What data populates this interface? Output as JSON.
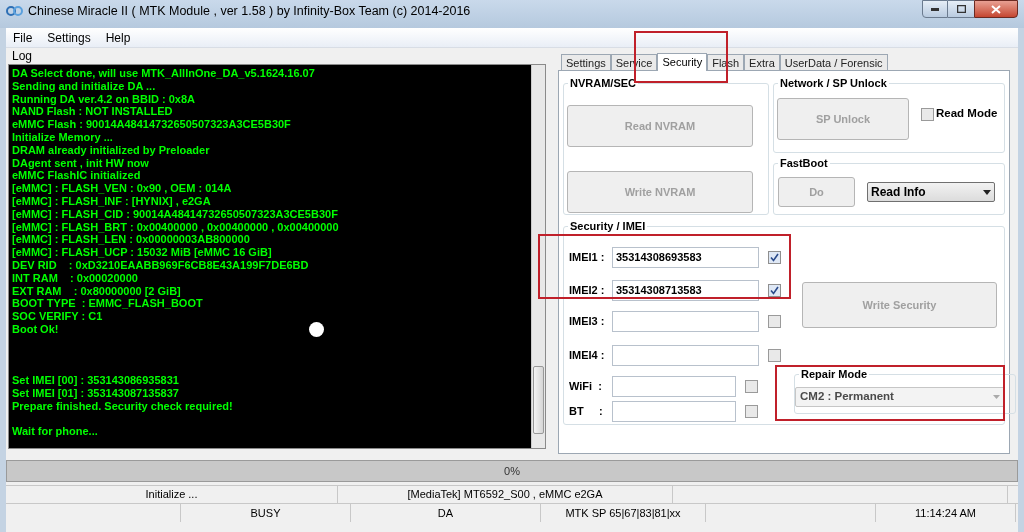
{
  "window": {
    "title": "Chinese Miracle II ( MTK Module , ver 1.58 ) by Infinity-Box Team (c) 2014-2016"
  },
  "menu": [
    "File",
    "Settings",
    "Help"
  ],
  "log": {
    "label": "Log",
    "blocks": [
      {
        "kind": "text",
        "lines": [
          "DA Select done, will use MTK_AllInOne_DA_v5.1624.16.07",
          "Sending and initialize DA ...",
          "Running DA ver.4.2 on BBID : 0x8A",
          "NAND Flash : NOT INSTALLED",
          "eMMC Flash : 90014A48414732650507323A3CE5B30F",
          "Initialize Memory ...",
          "DRAM already initialized by Preloader",
          "DAgent sent , init HW now",
          "eMMC FlashIC initialized",
          "[eMMC] : FLASH_VEN : 0x90 , OEM : 014A",
          "[eMMC] : FLASH_INF : [HYNIX] , e2GA",
          "[eMMC] : FLASH_CID : 90014A48414732650507323A3CE5B30F",
          "[eMMC] : FLASH_BRT : 0x00400000 , 0x00400000 , 0x00400000",
          "[eMMC] : FLASH_LEN : 0x00000003AB800000",
          "[eMMC] : FLASH_UCP : 15032 MiB [eMMC 16 GiB]",
          "DEV RID    : 0xD3210EAABB969F6CB8E43A199F7DE6BD",
          "INT RAM    : 0x00020000",
          "EXT RAM    : 0x80000000 [2 GiB]",
          "BOOT TYPE  : EMMC_FLASH_BOOT",
          "SOC VERIFY : C1",
          "Boot Ok!"
        ]
      },
      {
        "kind": "blank"
      },
      {
        "kind": "blank"
      },
      {
        "kind": "blank"
      },
      {
        "kind": "text",
        "lines": [
          "Set IMEI [00] : 353143086935831",
          "Set IMEI [01] : 353143087135837",
          "Prepare finished. Security check required!"
        ]
      },
      {
        "kind": "blank"
      },
      {
        "kind": "text",
        "lines": [
          "Wait for phone..."
        ]
      }
    ]
  },
  "tabs": [
    {
      "label": "Settings",
      "selected": false
    },
    {
      "label": "Service",
      "selected": false
    },
    {
      "label": "Security",
      "selected": true
    },
    {
      "label": "Flash",
      "selected": false
    },
    {
      "label": "Extra",
      "selected": false
    },
    {
      "label": "UserData / Forensic",
      "selected": false
    }
  ],
  "nvram": {
    "title": "NVRAM/SEC",
    "buttons": [
      {
        "label": "Read NVRAM",
        "disabled": true
      },
      {
        "label": "Write NVRAM",
        "disabled": true
      }
    ]
  },
  "network": {
    "title": "Network / SP Unlock",
    "button": {
      "label": "SP Unlock",
      "disabled": true
    },
    "read_mode": {
      "label": "Read Mode",
      "checked": false
    }
  },
  "fastboot": {
    "title": "FastBoot",
    "button": {
      "label": "Do",
      "disabled": true
    },
    "select": {
      "value": "Read Info"
    }
  },
  "security": {
    "title": "Security / IMEI",
    "fields": [
      {
        "label": "IMEI1 :",
        "value": "35314308693583",
        "checked": true
      },
      {
        "label": "IMEI2 :",
        "value": "35314308713583",
        "checked": true
      },
      {
        "label": "IMEI3 :",
        "checked": false
      },
      {
        "label": "IMEI4 :",
        "checked": false
      },
      {
        "label": "WiFi  :",
        "checked": false
      },
      {
        "label": "BT     :",
        "checked": false
      }
    ],
    "button": {
      "label": "Write Security",
      "disabled": true
    },
    "repair_mode": {
      "title": "Repair Mode",
      "value": "CM2 : Permanent",
      "disabled": true
    }
  },
  "progress": {
    "text": "0%",
    "level": 0
  },
  "status_bar": {
    "row_1": [
      "Initialize ...",
      "[MediaTek] MT6592_S00 , eMMC e2GA"
    ],
    "row_2": [
      "BUSY",
      "DA",
      "MTK SP 65|67|83|81|xx",
      "11:14:24 AM"
    ]
  }
}
